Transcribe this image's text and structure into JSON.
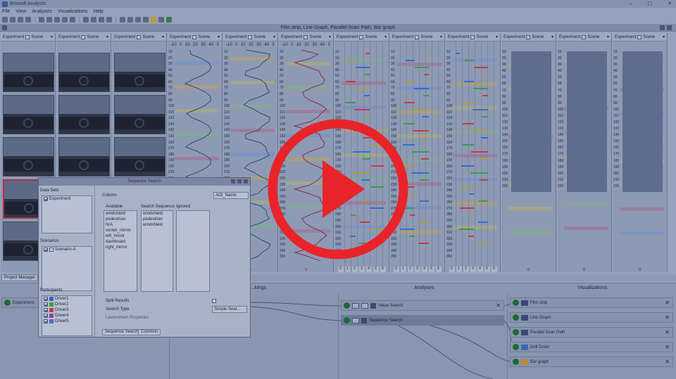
{
  "window": {
    "title": "Brixsoft Analysis",
    "controls": [
      "–",
      "▢",
      "✕"
    ]
  },
  "menu": [
    "File",
    "View",
    "Analyses",
    "Visualizations",
    "Help"
  ],
  "strip": {
    "title": "Film strip, Line Graph, Parallel Scan Path, Bar graph"
  },
  "panel_header": {
    "experiment": "Experiment",
    "scene": "Scene"
  },
  "line_axis": [
    "-10",
    "0",
    "10",
    "20",
    "30",
    "40",
    "5"
  ],
  "y_ticks": [
    "10",
    "20",
    "30",
    "40",
    "50",
    "60",
    "70",
    "80",
    "90",
    "100",
    "110",
    "120",
    "130",
    "140",
    "150",
    "160",
    "170",
    "180",
    "190",
    "200",
    "210",
    "220",
    "230",
    "240",
    "250",
    "260",
    "270",
    "280",
    "290",
    "300",
    "310",
    "320",
    "330",
    "340",
    "350"
  ],
  "bar_ticks": [
    "0",
    "1",
    "2",
    "3",
    "4",
    "5",
    "6"
  ],
  "bottom_zero": "0",
  "lower": {
    "project_manager_tab": "Project Manager",
    "col_recordings": "...kings",
    "col_analyses": "Analyses",
    "col_visualizations": "Visualizations",
    "experiment_node": "Experiment",
    "analyses": [
      {
        "label": "Value Search",
        "highlight": false
      },
      {
        "label": "Sequence Search",
        "highlight": true
      }
    ],
    "visualizations": [
      "Film strip",
      "Line Graph",
      "Parallel Scan Path",
      "Drill Down",
      "Bar graph"
    ]
  },
  "dialog": {
    "title": "Sequence Search",
    "data_sets_label": "Data Sets",
    "data_sets": [
      "Experiment"
    ],
    "scenarios_label": "Scenarios",
    "scenarios": [
      "Scenario-A"
    ],
    "participants_label": "Participants",
    "participants": [
      {
        "name": "Driver1",
        "color": "#3b63b8"
      },
      {
        "name": "Driver2",
        "color": "#3a9e4a"
      },
      {
        "name": "Driver3",
        "color": "#c93a3a"
      },
      {
        "name": "Driver4",
        "color": "#8a3fb2"
      },
      {
        "name": "Driver5",
        "color": "#4a6fc2"
      }
    ],
    "column_label": "Column",
    "column_value": "AOI_Name",
    "available_label": "Available",
    "available": [
      "windshield",
      "pedestrian",
      "N/A",
      "center_mirror",
      "left_mirror",
      "dashboard",
      "right_mirror"
    ],
    "search_seq_label": "Search Sequence",
    "search_seq": [
      "windshield",
      "pedestrian",
      "windshield"
    ],
    "ignored_label": "Ignored",
    "split_results": "Split Results",
    "search_type_label": "Search Type",
    "search_type_value": "Simple Sear...",
    "levenshtein": "Levenshtein Properties",
    "tab_search": "Sequence Search",
    "tab_common": "Common"
  },
  "colors": {
    "play_red": "#e8242a",
    "accent_dark": "#1b6a33"
  }
}
